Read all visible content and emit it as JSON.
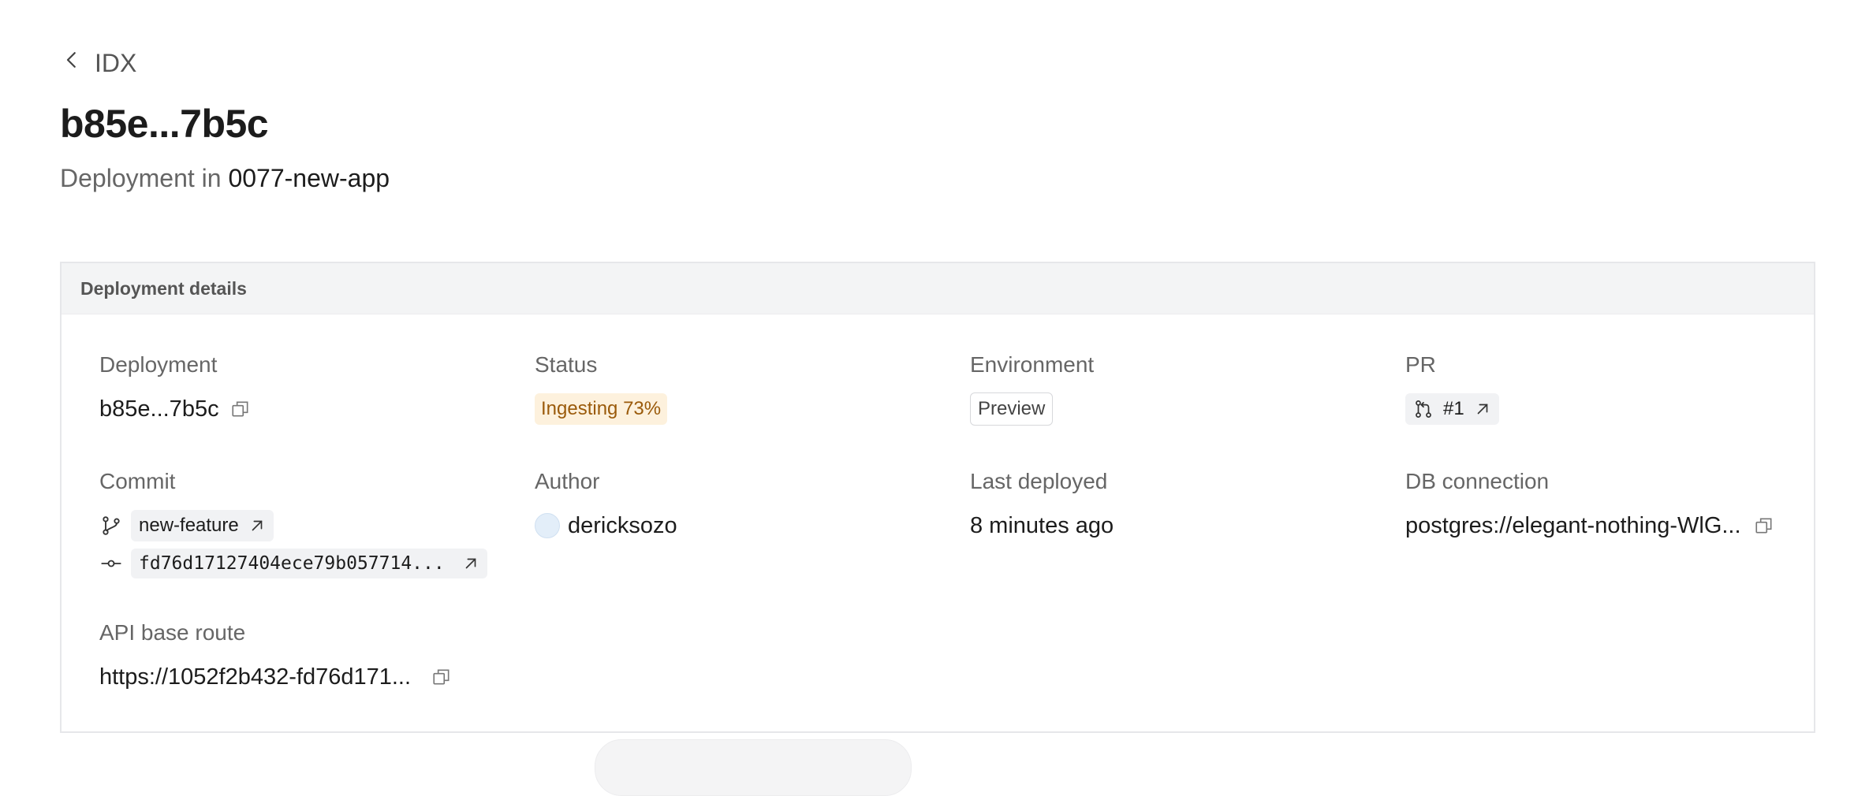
{
  "nav": {
    "back_label": "IDX"
  },
  "page": {
    "title": "b85e...7b5c",
    "subtitle_prefix": "Deployment in",
    "project": "0077-new-app"
  },
  "card": {
    "header": "Deployment details",
    "deployment": {
      "label": "Deployment",
      "value": "b85e...7b5c"
    },
    "status": {
      "label": "Status",
      "value": "Ingesting 73%"
    },
    "environment": {
      "label": "Environment",
      "value": "Preview"
    },
    "pr": {
      "label": "PR",
      "value": "#1"
    },
    "commit": {
      "label": "Commit",
      "branch": "new-feature",
      "sha": "fd76d17127404ece79b057714..."
    },
    "author": {
      "label": "Author",
      "value": "dericksozo"
    },
    "last_deployed": {
      "label": "Last deployed",
      "value": "8 minutes ago"
    },
    "db_connection": {
      "label": "DB connection",
      "value": "postgres://elegant-nothing-WlG..."
    },
    "api_base_route": {
      "label": "API base route",
      "value": "https://1052f2b432-fd76d171..."
    }
  },
  "colors": {
    "status_bg": "#fdf1dd",
    "status_text": "#9a5a0a",
    "card_header_bg": "#f3f4f5"
  },
  "icons": [
    "chevron-left-icon",
    "copy-icon",
    "pull-request-icon",
    "external-link-icon",
    "branch-icon",
    "commit-icon"
  ]
}
